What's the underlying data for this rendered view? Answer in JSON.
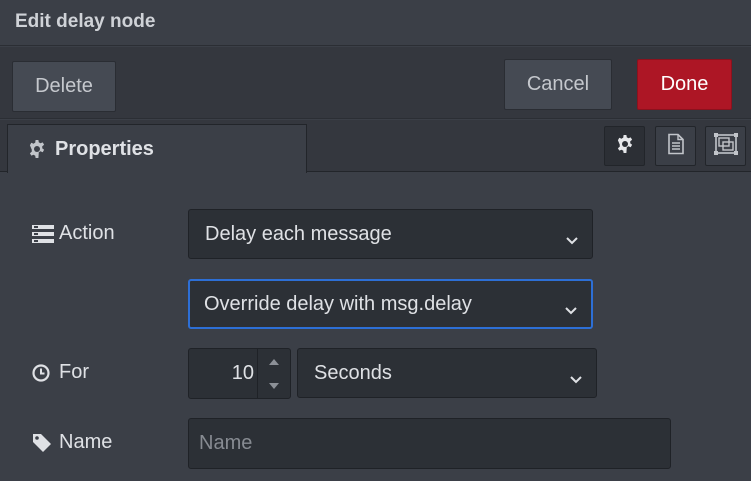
{
  "dialog": {
    "title": "Edit delay node"
  },
  "toolbar": {
    "delete_label": "Delete",
    "cancel_label": "Cancel",
    "done_label": "Done"
  },
  "tabs": {
    "properties_label": "Properties",
    "icons": [
      "gear-icon",
      "description-icon",
      "appearance-icon"
    ]
  },
  "form": {
    "action": {
      "label": "Action",
      "value": "Delay each message"
    },
    "delay_mode": {
      "value": "Override delay with msg.delay"
    },
    "for": {
      "label": "For",
      "amount": "10",
      "unit": "Seconds"
    },
    "name": {
      "label": "Name",
      "value": "",
      "placeholder": "Name"
    }
  },
  "colors": {
    "accent": "#ad1625",
    "focus": "#2d6fd6",
    "background": "#3b3f47"
  }
}
